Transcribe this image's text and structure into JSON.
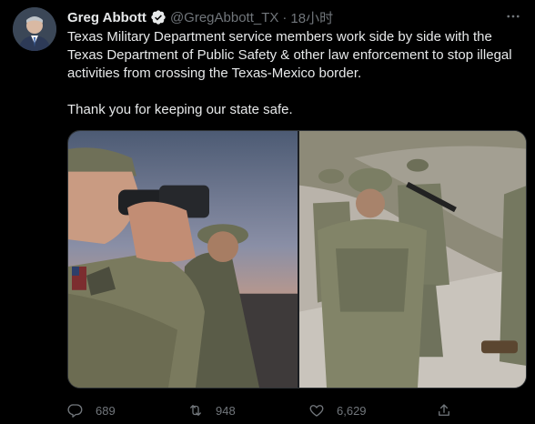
{
  "author": {
    "name": "Greg Abbott",
    "handle": "@GregAbbott_TX",
    "separator": "·",
    "time": "18小时",
    "verified": true
  },
  "tweet": {
    "paragraph_1": "Texas Military Department service members work side by side with the Texas Department of Public Safety & other law enforcement to stop illegal activities from crossing the Texas-Mexico border.",
    "paragraph_2": "Thank you for keeping our state safe."
  },
  "metrics": {
    "replies": "689",
    "retweets": "948",
    "likes": "6,629"
  },
  "icons": {
    "verified": "verified-badge-icon",
    "more": "more-options-icon",
    "reply": "reply-icon",
    "retweet": "retweet-icon",
    "like": "heart-icon",
    "share": "share-icon"
  },
  "colors": {
    "background": "#000000",
    "text_primary": "#e7e9ea",
    "text_secondary": "#71767b",
    "verified_blue": "#1d9bf0"
  }
}
